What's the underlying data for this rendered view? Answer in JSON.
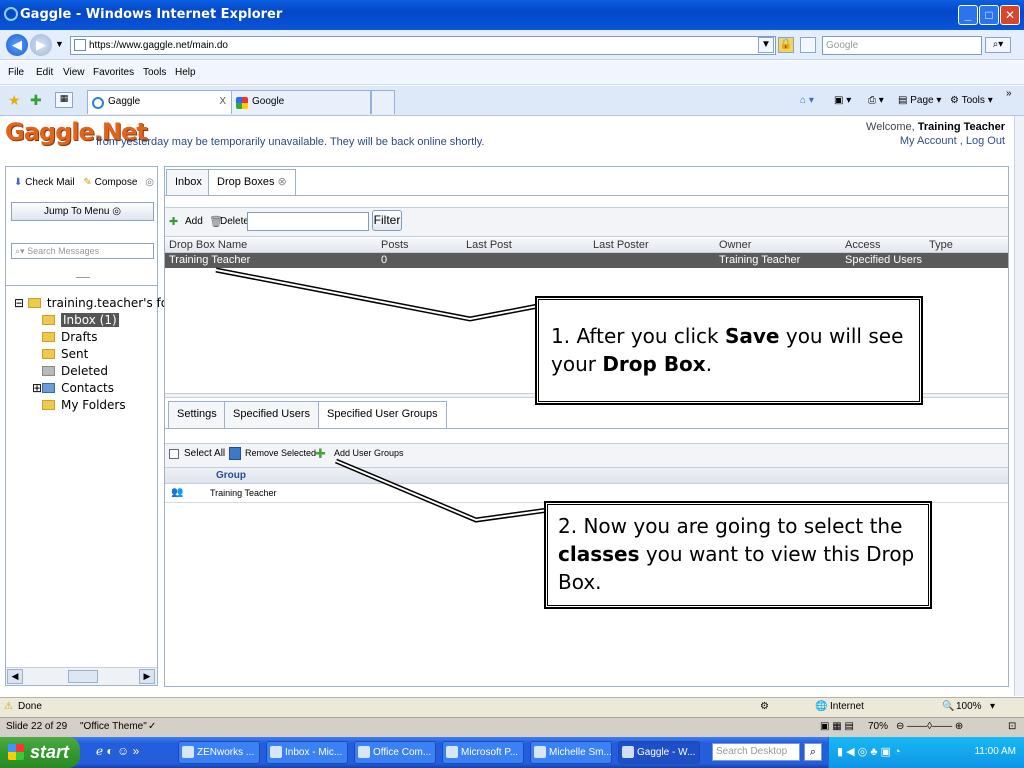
{
  "window": {
    "title": "Gaggle - Windows Internet Explorer",
    "address": "https://www.gaggle.net/main.do",
    "search_placeholder": "Google",
    "menu": [
      "File",
      "Edit",
      "View",
      "Favorites",
      "Tools",
      "Help"
    ],
    "tabs": [
      {
        "label": "Gaggle",
        "close": "X"
      },
      {
        "label": "Google"
      }
    ],
    "page_label": "Page",
    "tools_label": "Tools"
  },
  "gaggle": {
    "logo": "Gaggle.Net",
    "notice": "from yesterday may be temporarily unavailable. They will be back online shortly.",
    "welcome_prefix": "Welcome, ",
    "welcome_user": "Training Teacher",
    "account_links": "My Account , Log Out"
  },
  "sidebar": {
    "check_mail": "Check Mail",
    "compose": "Compose",
    "jump_menu": "Jump To Menu",
    "search_placeholder": "Search Messages",
    "tree_root": "training.teacher's fold",
    "folders": [
      "Inbox (1)",
      "Drafts",
      "Sent",
      "Deleted",
      "Contacts",
      "My Folders"
    ]
  },
  "main": {
    "tabs": [
      "Inbox",
      "Drop Boxes"
    ],
    "add_label": "Add",
    "delete_label": "Delete",
    "filter_label": "Filter",
    "columns": [
      "Drop Box Name",
      "Posts",
      "Last Post",
      "Last Poster",
      "Owner",
      "Access",
      "Type"
    ],
    "row": {
      "name": "Training Teacher",
      "posts": "0",
      "last_post": "",
      "last_poster": "",
      "owner": "Training Teacher",
      "access": "Specified Users",
      "type": ""
    },
    "lower_tabs": [
      "Settings",
      "Specified Users",
      "Specified User Groups"
    ],
    "select_all": "Select All",
    "remove_selected": "Remove Selected",
    "add_user_groups": "Add User Groups",
    "group_header": "Group",
    "group_row": "Training Teacher"
  },
  "callouts": {
    "one": {
      "a": "1.  After you click ",
      "b": "Save",
      "c": " you will see your ",
      "d": "Drop Box",
      "e": "."
    },
    "two": {
      "a": "2.  Now you are going to select the ",
      "b": "classes",
      "c": " you want to view this Drop Box."
    }
  },
  "status": {
    "done": "Done",
    "zone": "Internet",
    "zoom": "100%"
  },
  "ppt": {
    "slide": "Slide 22 of 29",
    "theme": "\"Office Theme\"",
    "zoom": "70%"
  },
  "taskbar": {
    "start": "start",
    "tasks": [
      "ZENworks ...",
      "Inbox - Mic...",
      "Office Com...",
      "Microsoft P...",
      "Michelle Sm...",
      "Gaggle - W..."
    ],
    "search_placeholder": "Search Desktop",
    "clock": "11:00 AM"
  }
}
